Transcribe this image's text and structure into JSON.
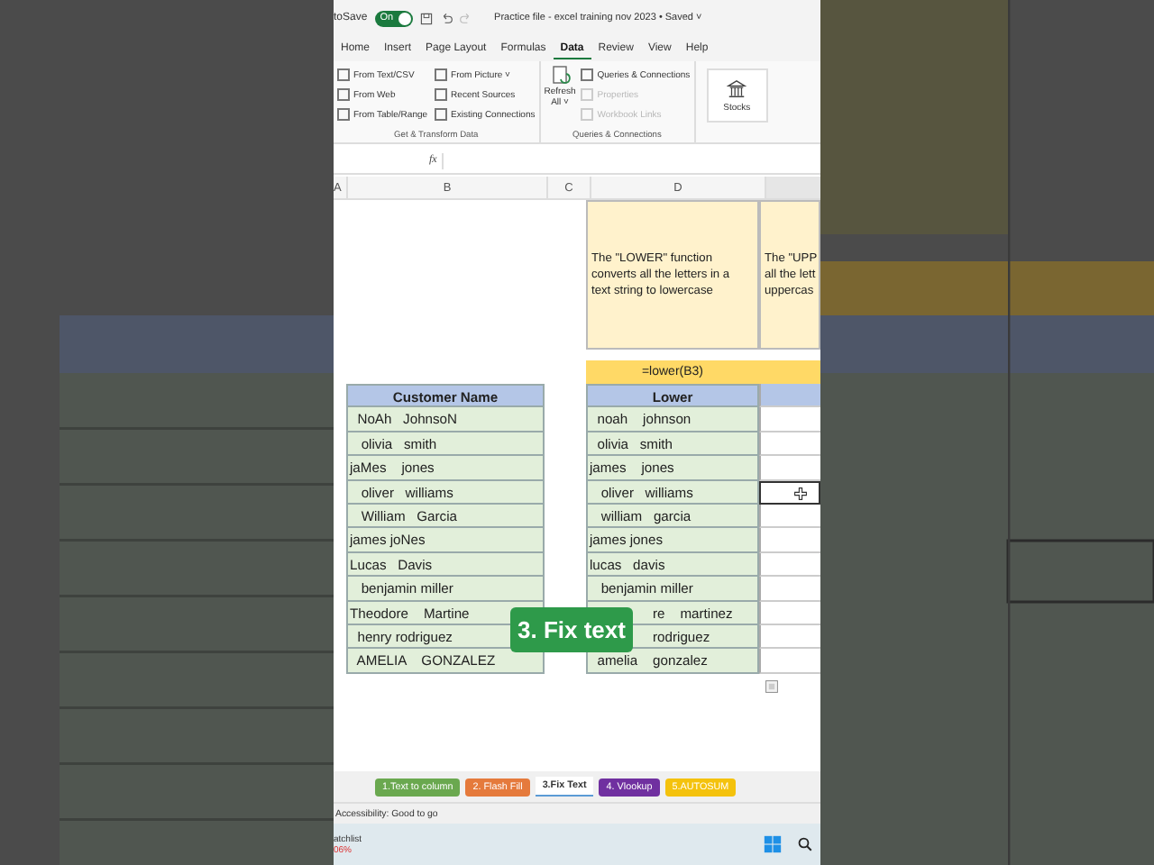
{
  "title_bar": {
    "autosave_label": "toSave",
    "autosave_on": true,
    "toggle_label": "On",
    "title": "Practice file - excel training nov 2023 • Saved ˅"
  },
  "ribbon_tabs": [
    {
      "label": "Home",
      "selected": false
    },
    {
      "label": "Insert",
      "selected": false
    },
    {
      "label": "Page Layout",
      "selected": false
    },
    {
      "label": "Formulas",
      "selected": false
    },
    {
      "label": "Data",
      "selected": true
    },
    {
      "label": "Review",
      "selected": false
    },
    {
      "label": "View",
      "selected": false
    },
    {
      "label": "Help",
      "selected": false
    }
  ],
  "ribbon_groups": [
    {
      "title": "Get & Transform Data",
      "items": [
        {
          "label": "From Text/CSV",
          "disabled": false
        },
        {
          "label": "From Web",
          "disabled": false
        },
        {
          "label": "From Table/Range",
          "disabled": false
        },
        {
          "label": "From Picture ˅",
          "disabled": false
        },
        {
          "label": "Recent Sources",
          "disabled": false
        },
        {
          "label": "Existing Connections",
          "disabled": false
        }
      ]
    },
    {
      "title": "Queries & Connections",
      "big_button": [
        "Refresh",
        "All ˅"
      ],
      "items": [
        {
          "label": "Queries & Connections",
          "disabled": false
        },
        {
          "label": "Properties",
          "disabled": true
        },
        {
          "label": "Workbook Links",
          "disabled": true
        }
      ]
    }
  ],
  "stocks_button": "Stocks",
  "formula_bar": {
    "fx": "fx"
  },
  "columns": [
    "A",
    "B",
    "C",
    "D"
  ],
  "notes": [
    [
      "The \"LOWER\" function",
      "converts all the letters in a",
      "text string to lowercase"
    ],
    [
      "The \"UPP",
      "all the lett",
      "uppercas"
    ]
  ],
  "formula_cell": "=lower(B3)",
  "table": {
    "headers": [
      "Customer Name",
      "Lower"
    ],
    "rows": [
      {
        "name": "  NoAh   JohnsoN",
        "lower": "  noah    johnson",
        "kind": "full",
        "selected": false
      },
      {
        "name": "   olivia   smith",
        "lower": "  olivia   smith",
        "kind": "full",
        "selected": false
      },
      {
        "name": "jaMes    jones",
        "lower": "james    jones",
        "kind": "full",
        "selected": false
      },
      {
        "name": "   oliver   williams",
        "lower": "   oliver   williams",
        "kind": "full",
        "selected": true
      },
      {
        "name": "   William   Garcia",
        "lower": "   william   garcia",
        "kind": "full",
        "selected": false
      },
      {
        "name": "james joNes",
        "lower": "james jones",
        "kind": "full",
        "selected": false
      },
      {
        "name": "Lucas   Davis",
        "lower": "lucas   davis",
        "kind": "full",
        "selected": false
      },
      {
        "name": "   benjamin miller",
        "lower": "   benjamin miller",
        "kind": "full",
        "selected": false
      },
      {
        "name": "Theodore    Martine",
        "lower": "re    martinez",
        "kind": "partial",
        "selected": false
      },
      {
        "name": "  henry rodriguez",
        "lower": "rodriguez",
        "kind": "partial",
        "selected": false
      },
      {
        "name": "  AMELIA    GONZALEZ",
        "lower": "  amelia    gonzalez",
        "kind": "full",
        "selected": false
      }
    ]
  },
  "overlay_caption": "3. Fix text",
  "sheet_tabs": [
    {
      "label": "1.Text to column",
      "color": "#6aa84f",
      "selected": false
    },
    {
      "label": "2. Flash Fill",
      "color": "#e57a3c",
      "selected": false
    },
    {
      "label": "3.Fix Text",
      "color": "#5b9bd5",
      "selected": true
    },
    {
      "label": "4. Vlookup",
      "color": "#7030a0",
      "selected": false
    },
    {
      "label": "5.AUTOSUM",
      "color": "#f4c20d",
      "selected": false
    }
  ],
  "status_bar": {
    "text": "Accessibility: Good to go"
  },
  "taskbar": {
    "widget_title": "atchlist",
    "widget_value": "06%"
  }
}
